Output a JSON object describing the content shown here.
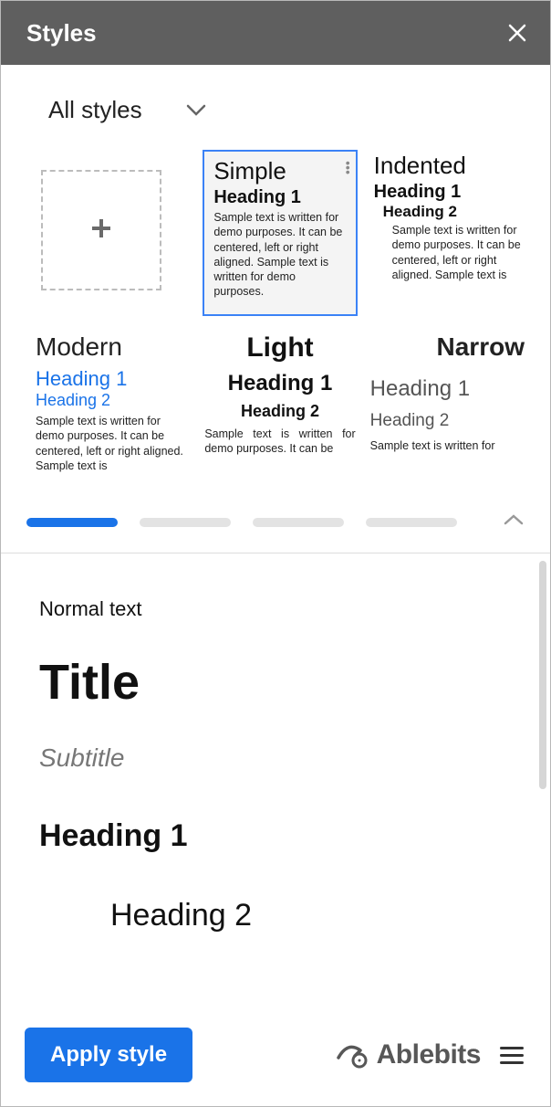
{
  "header": {
    "title": "Styles"
  },
  "filter": {
    "label": "All styles"
  },
  "cards": {
    "simple": {
      "title": "Simple",
      "h1": "Heading 1",
      "sample": "Sample text is written for demo purposes. It can be centered, left or right aligned. Sample text is written for demo purposes."
    },
    "indented": {
      "title": "Indented",
      "h1": "Heading 1",
      "h2": "Heading 2",
      "sample": "Sample text is written for demo purposes. It can be centered, left or right aligned. Sample text is"
    },
    "modern": {
      "title": "Modern",
      "h1": "Heading 1",
      "h2": "Heading 2",
      "sample": "Sample text is written for demo purposes. It can be centered, left or right aligned. Sample text is"
    },
    "light": {
      "title": "Light",
      "h1": "Heading 1",
      "h2": "Heading 2",
      "sample": "Sample text is written for demo purposes. It can be"
    },
    "narrow": {
      "title": "Narrow",
      "h1": "Heading 1",
      "h2": "Heading 2",
      "sample": "Sample text is written for"
    }
  },
  "preview": {
    "normal": "Normal text",
    "title": "Title",
    "subtitle": "Subtitle",
    "h1": "Heading 1",
    "h2": "Heading 2"
  },
  "footer": {
    "apply": "Apply style",
    "brand": "Ablebits"
  }
}
